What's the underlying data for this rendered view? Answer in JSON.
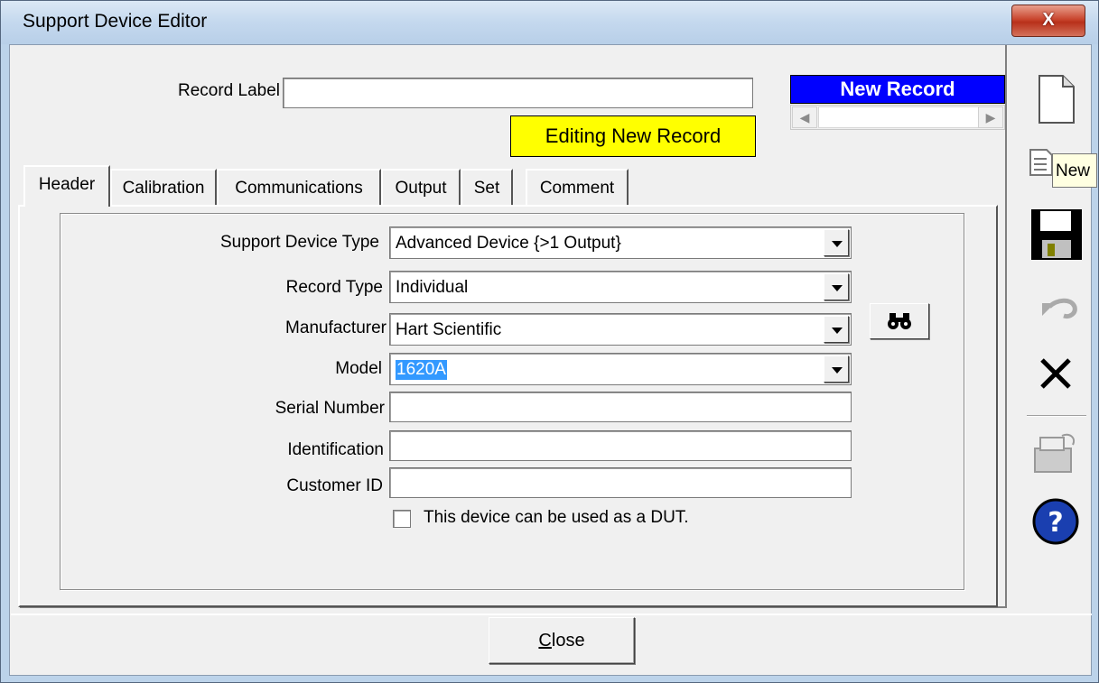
{
  "window": {
    "title": "Support Device Editor",
    "close_glyph": "X"
  },
  "record_label": {
    "label": "Record Label",
    "value": ""
  },
  "status": {
    "record_indicator": "New Record",
    "editing_indicator": "Editing New Record"
  },
  "tabs": [
    {
      "label": "Header",
      "active": true
    },
    {
      "label": "Calibration",
      "active": false
    },
    {
      "label": "Communications",
      "active": false
    },
    {
      "label": "Output",
      "active": false
    },
    {
      "label": "Set",
      "active": false
    },
    {
      "label": "Comment",
      "active": false
    }
  ],
  "form": {
    "support_device_type": {
      "label": "Support Device Type",
      "value": "Advanced Device {>1 Output}"
    },
    "record_type": {
      "label": "Record Type",
      "value": "Individual"
    },
    "manufacturer": {
      "label": "Manufacturer",
      "value": "Hart Scientific"
    },
    "model": {
      "label": "Model",
      "value": "1620A"
    },
    "serial_number": {
      "label": "Serial Number",
      "value": ""
    },
    "identification": {
      "label": "Identification",
      "value": ""
    },
    "customer_id": {
      "label": "Customer ID",
      "value": ""
    },
    "dut_checkbox": {
      "label": "This device can be used as a DUT.",
      "checked": false
    }
  },
  "toolbar": {
    "tooltip": "New",
    "icons": [
      "new-document-icon",
      "copy-document-icon",
      "save-icon",
      "undo-icon",
      "delete-icon",
      "print-icon",
      "help-icon"
    ]
  },
  "footer": {
    "close_label": "Close"
  },
  "colors": {
    "record_indicator_bg": "#0000ff",
    "editing_indicator_bg": "#ffff00",
    "selection": "#3399ff"
  }
}
